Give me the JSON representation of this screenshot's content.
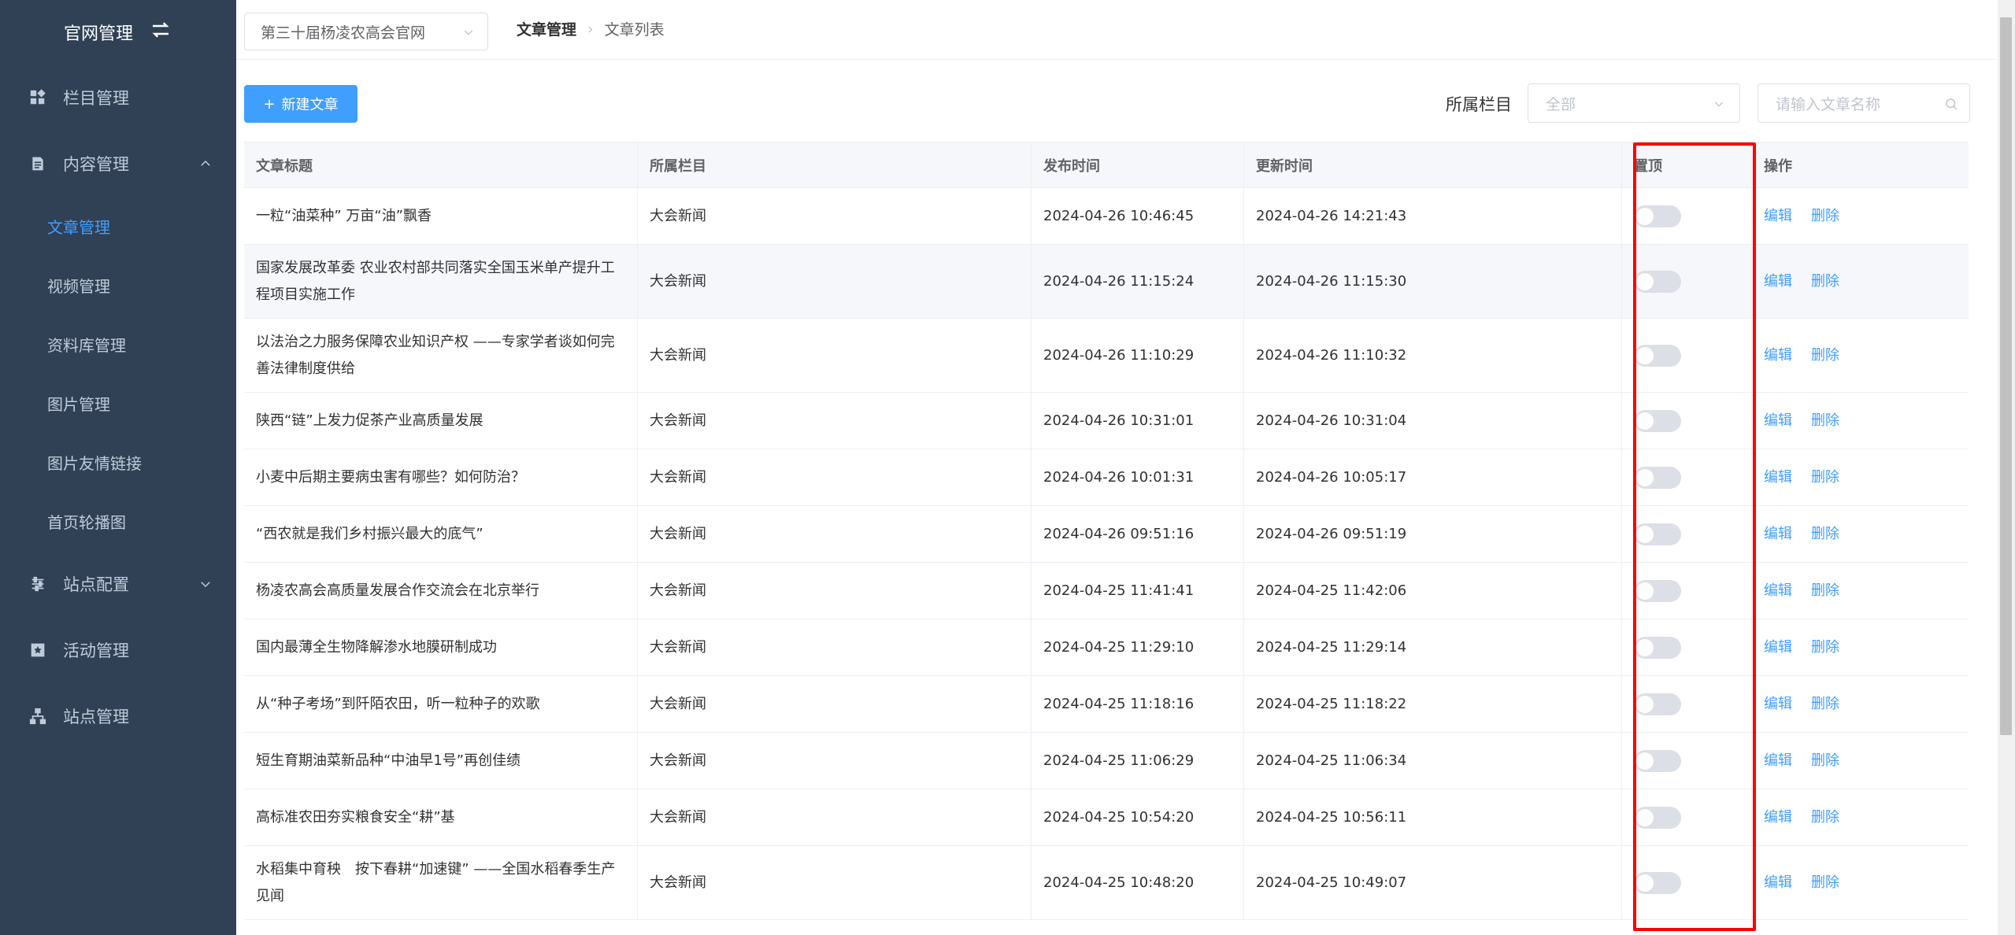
{
  "sidebar": {
    "brand": "官网管理",
    "menu": [
      {
        "label": "栏目管理",
        "icon": "widget-icon"
      },
      {
        "label": "内容管理",
        "icon": "document-icon",
        "expanded": true
      },
      {
        "label": "站点配置",
        "icon": "settings-icon",
        "expanded": false
      },
      {
        "label": "活动管理",
        "icon": "star-icon"
      },
      {
        "label": "站点管理",
        "icon": "tree-icon"
      }
    ],
    "content_sub": [
      "文章管理",
      "视频管理",
      "资料库管理",
      "图片管理",
      "图片友情链接",
      "首页轮播图"
    ],
    "active": "文章管理"
  },
  "topbar": {
    "site_select": "第三十届杨凌农高会官网",
    "breadcrumb": [
      "文章管理",
      "文章列表"
    ]
  },
  "toolbar": {
    "new_button": "新建文章",
    "filter_label": "所属栏目",
    "category_placeholder": "全部",
    "search_placeholder": "请输入文章名称"
  },
  "table": {
    "headers": [
      "文章标题",
      "所属栏目",
      "发布时间",
      "更新时间",
      "置顶",
      "操作"
    ],
    "actions": {
      "edit": "编辑",
      "delete": "删除"
    },
    "rows": [
      {
        "title": "一粒“油菜种” 万亩“油”飘香",
        "category": "大会新闻",
        "published": "2024-04-26 10:46:45",
        "updated": "2024-04-26 14:21:43",
        "pinned": false
      },
      {
        "title": "国家发展改革委 农业农村部共同落实全国玉米单产提升工程项目实施工作",
        "category": "大会新闻",
        "published": "2024-04-26 11:15:24",
        "updated": "2024-04-26 11:15:30",
        "pinned": false
      },
      {
        "title": "以法治之力服务保障农业知识产权 ——专家学者谈如何完善法律制度供给",
        "category": "大会新闻",
        "published": "2024-04-26 11:10:29",
        "updated": "2024-04-26 11:10:32",
        "pinned": false
      },
      {
        "title": "陕西“链”上发力促茶产业高质量发展",
        "category": "大会新闻",
        "published": "2024-04-26 10:31:01",
        "updated": "2024-04-26 10:31:04",
        "pinned": false
      },
      {
        "title": "小麦中后期主要病虫害有哪些？如何防治？",
        "category": "大会新闻",
        "published": "2024-04-26 10:01:31",
        "updated": "2024-04-26 10:05:17",
        "pinned": false
      },
      {
        "title": "“西农就是我们乡村振兴最大的底气”",
        "category": "大会新闻",
        "published": "2024-04-26 09:51:16",
        "updated": "2024-04-26 09:51:19",
        "pinned": false
      },
      {
        "title": "杨凌农高会高质量发展合作交流会在北京举行",
        "category": "大会新闻",
        "published": "2024-04-25 11:41:41",
        "updated": "2024-04-25 11:42:06",
        "pinned": false
      },
      {
        "title": "国内最薄全生物降解渗水地膜研制成功",
        "category": "大会新闻",
        "published": "2024-04-25 11:29:10",
        "updated": "2024-04-25 11:29:14",
        "pinned": false
      },
      {
        "title": "从“种子考场”到阡陌农田，听一粒种子的欢歌",
        "category": "大会新闻",
        "published": "2024-04-25 11:18:16",
        "updated": "2024-04-25 11:18:22",
        "pinned": false
      },
      {
        "title": "短生育期油菜新品种“中油早1号”再创佳绩",
        "category": "大会新闻",
        "published": "2024-04-25 11:06:29",
        "updated": "2024-04-25 11:06:34",
        "pinned": false
      },
      {
        "title": "高标准农田夯实粮食安全“耕”基",
        "category": "大会新闻",
        "published": "2024-04-25 10:54:20",
        "updated": "2024-04-25 10:56:11",
        "pinned": false
      },
      {
        "title": "水稻集中育秧　按下春耕“加速键” ——全国水稻春季生产见闻",
        "category": "大会新闻",
        "published": "2024-04-25 10:48:20",
        "updated": "2024-04-25 10:49:07",
        "pinned": false
      }
    ]
  },
  "colors": {
    "sidebar_bg": "#304156",
    "accent": "#409eff",
    "highlight_box": "#ff0000"
  }
}
